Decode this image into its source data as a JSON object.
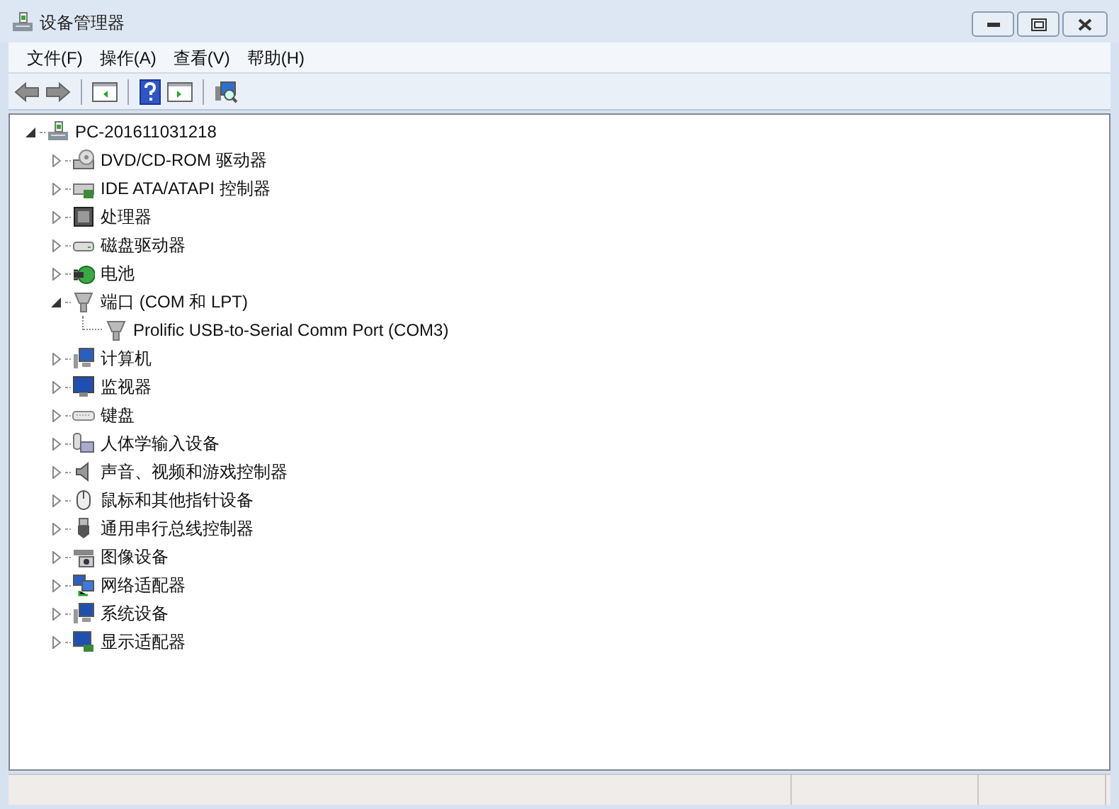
{
  "window": {
    "title": "设备管理器"
  },
  "menu": [
    "文件(F)",
    "操作(A)",
    "查看(V)",
    "帮助(H)"
  ],
  "tree": {
    "label": "PC-201611031218",
    "kind": "pc",
    "expanded": true,
    "children": [
      {
        "label": "DVD/CD-ROM 驱动器",
        "kind": "dvd",
        "expanded": false
      },
      {
        "label": "IDE ATA/ATAPI 控制器",
        "kind": "ide",
        "expanded": false
      },
      {
        "label": "处理器",
        "kind": "cpu",
        "expanded": false
      },
      {
        "label": "磁盘驱动器",
        "kind": "disk",
        "expanded": false
      },
      {
        "label": "电池",
        "kind": "battery",
        "expanded": false
      },
      {
        "label": "端口 (COM 和 LPT)",
        "kind": "port",
        "expanded": true,
        "children": [
          {
            "label": "Prolific USB-to-Serial Comm Port (COM3)",
            "kind": "port"
          }
        ]
      },
      {
        "label": "计算机",
        "kind": "computer",
        "expanded": false
      },
      {
        "label": "监视器",
        "kind": "monitor",
        "expanded": false
      },
      {
        "label": "键盘",
        "kind": "keyboard",
        "expanded": false
      },
      {
        "label": "人体学输入设备",
        "kind": "hid",
        "expanded": false
      },
      {
        "label": "声音、视频和游戏控制器",
        "kind": "sound",
        "expanded": false
      },
      {
        "label": "鼠标和其他指针设备",
        "kind": "mouse",
        "expanded": false
      },
      {
        "label": "通用串行总线控制器",
        "kind": "usb",
        "expanded": false
      },
      {
        "label": "图像设备",
        "kind": "camera",
        "expanded": false
      },
      {
        "label": "网络适配器",
        "kind": "network",
        "expanded": false
      },
      {
        "label": "系统设备",
        "kind": "system",
        "expanded": false
      },
      {
        "label": "显示适配器",
        "kind": "display",
        "expanded": false
      }
    ]
  }
}
